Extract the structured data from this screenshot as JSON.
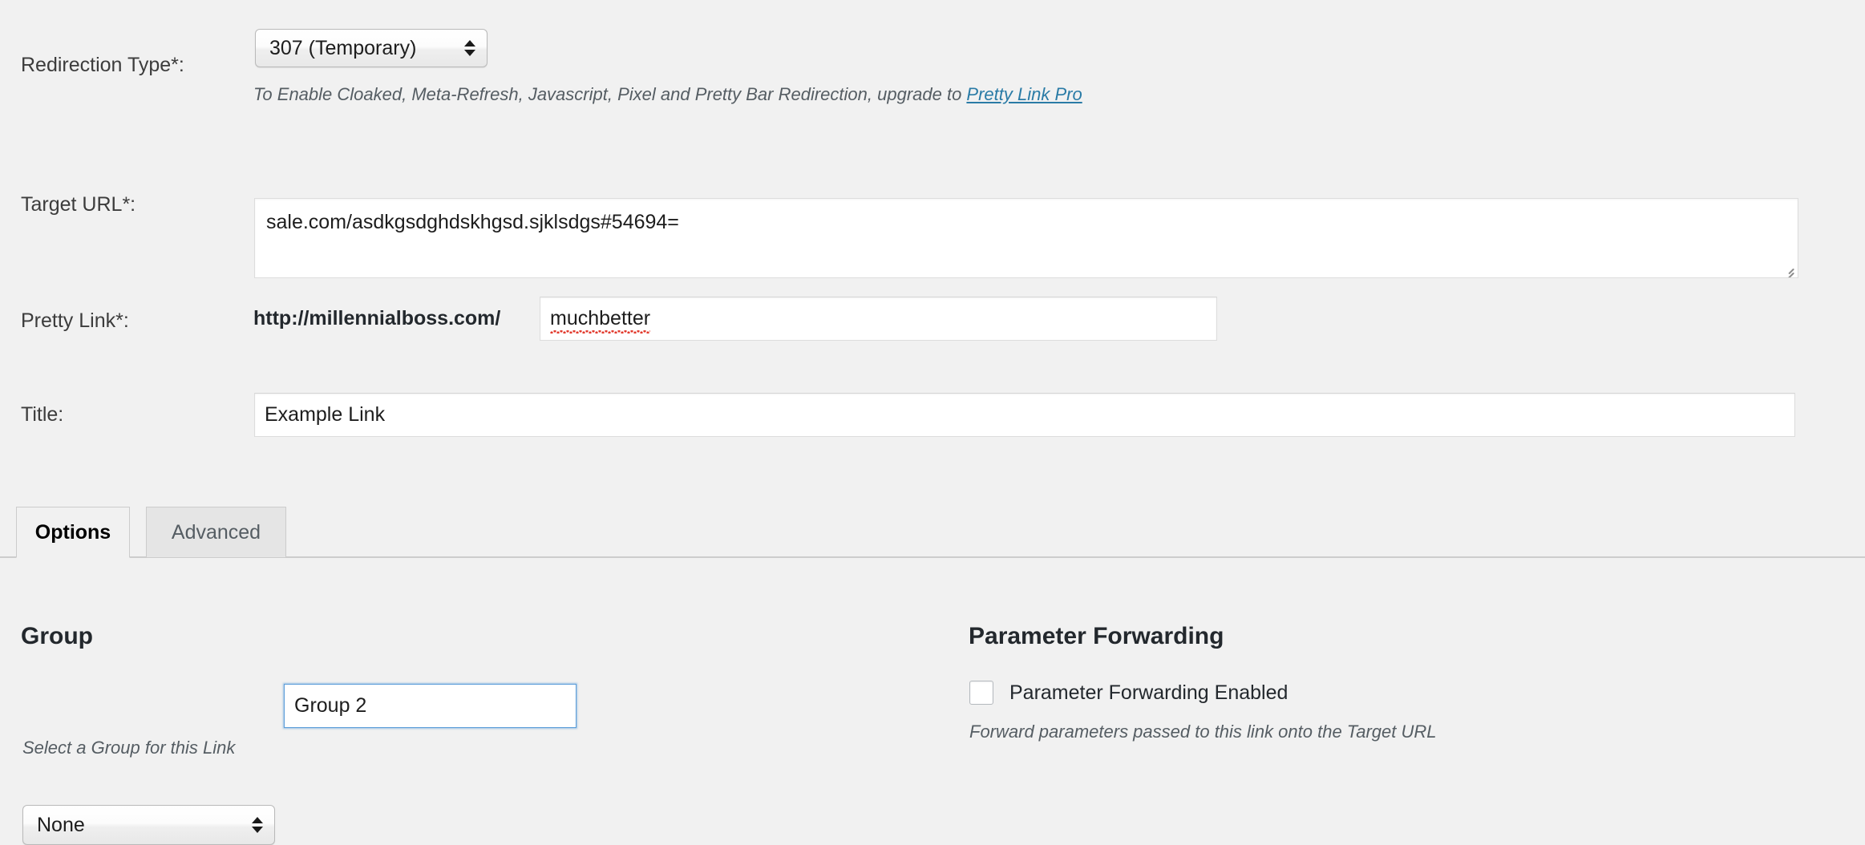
{
  "form": {
    "redirection": {
      "label": "Redirection Type*:",
      "selected": "307 (Temporary)",
      "help_prefix": "To Enable Cloaked, Meta-Refresh, Javascript, Pixel and Pretty Bar Redirection, upgrade to ",
      "help_link": "Pretty Link Pro"
    },
    "target_url": {
      "label": "Target URL*:",
      "value": "sale.com/asdkgsdghdskhgsd.sjklsdgs#54694="
    },
    "pretty_link": {
      "label": "Pretty Link*:",
      "prefix": "http://millennialboss.com/",
      "value": "muchbetter"
    },
    "title": {
      "label": "Title:",
      "value": "Example Link"
    }
  },
  "tabs": [
    {
      "label": "Options",
      "state": "active"
    },
    {
      "label": "Advanced",
      "state": "inactive"
    }
  ],
  "group_section": {
    "heading": "Group",
    "select_value": "None",
    "name_value": "Group 2",
    "help": "Select a Group for this Link"
  },
  "parameter_section": {
    "heading": "Parameter Forwarding",
    "checkbox_label": "Parameter Forwarding Enabled",
    "checked": false,
    "help": "Forward parameters passed to this link onto the Target URL"
  },
  "colors": {
    "page_bg": "#f1f1f1",
    "link": "#2a7ba6",
    "focus_border": "#5b9dd9",
    "spellcheck": "#e23b2e"
  }
}
